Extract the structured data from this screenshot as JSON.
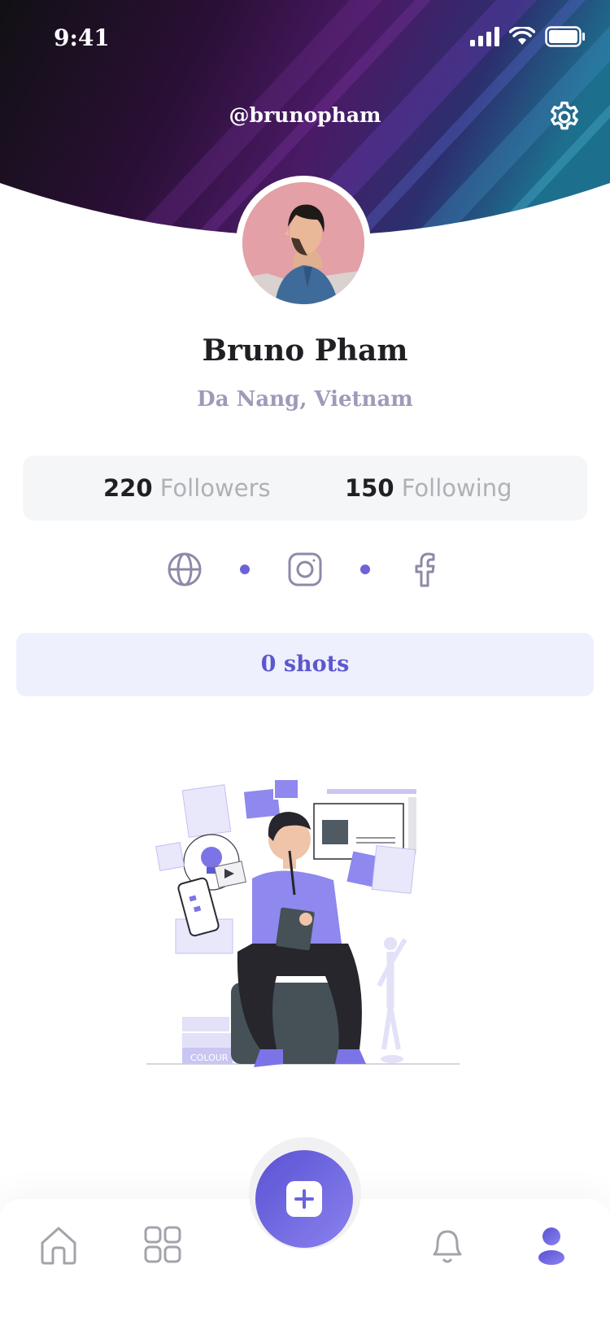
{
  "status_bar": {
    "time": "9:41"
  },
  "header": {
    "handle": "@brunopham"
  },
  "profile": {
    "name": "Bruno Pham",
    "location": "Da Nang, Vietnam"
  },
  "stats": {
    "followers_count": "220",
    "followers_label": "Followers",
    "following_count": "150",
    "following_label": "Following"
  },
  "socials": [
    "globe-icon",
    "instagram-icon",
    "facebook-icon"
  ],
  "shots_label": "0 shots",
  "illustration": {
    "book_label": "COLOUR"
  },
  "tab_bar": [
    "home-icon",
    "grid-icon",
    "add-button",
    "bell-icon",
    "profile-icon"
  ],
  "colors": {
    "accent": "#6c63d9",
    "stats_bg": "#f5f6f8",
    "shots_bg": "#eff0fd"
  }
}
